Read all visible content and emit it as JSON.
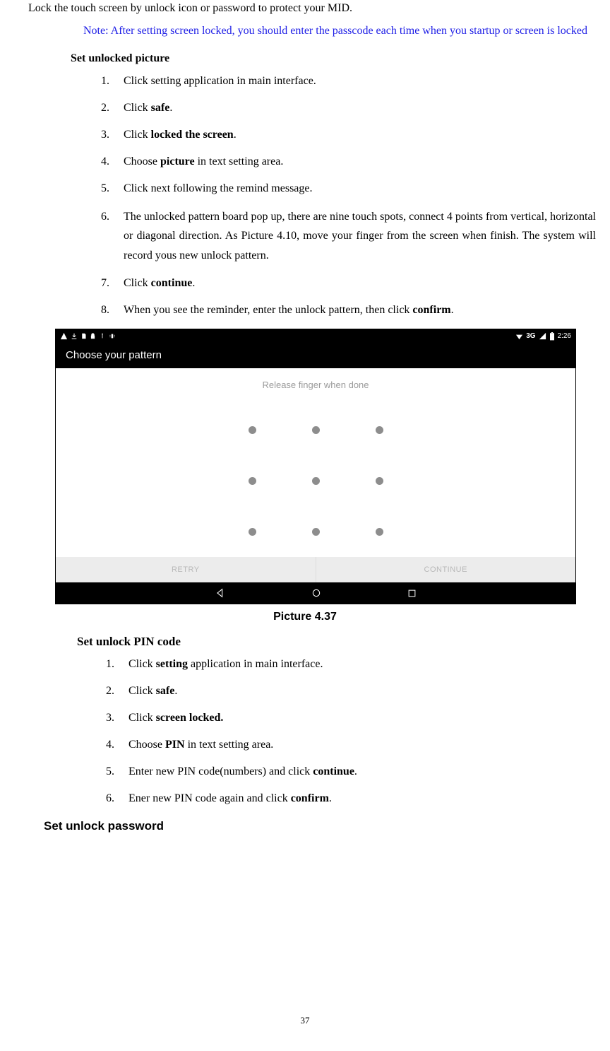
{
  "intro": "Lock the touch screen by unlock icon or password to protect your MID.",
  "note": "Note: After setting screen locked, you should enter the passcode each time when you startup or screen is locked",
  "section1_title": "Set unlocked picture",
  "s1": {
    "i1": {
      "pre": "Click setting application in main interface."
    },
    "i2": {
      "a": "Click ",
      "b": "safe",
      "c": "."
    },
    "i3": {
      "a": "Click ",
      "b": "locked the screen",
      "c": "."
    },
    "i4": {
      "a": "Choose ",
      "b": "picture",
      "c": " in text setting area."
    },
    "i5": {
      "pre": "Click next following the remind message."
    },
    "i6": {
      "pre": "The unlocked pattern board pop up, there are nine touch spots, connect 4 points from vertical, horizontal or diagonal direction. As Picture 4.10, move your finger from the screen when finish. The system will record yous new unlock pattern."
    },
    "i7": {
      "a": "Click ",
      "b": "continue",
      "c": "."
    },
    "i8": {
      "a": "When you see the reminder, enter the unlock pattern, then click ",
      "b": "confirm",
      "c": "."
    }
  },
  "shot": {
    "status_network": "3G",
    "status_time": "2:26",
    "title": "Choose your pattern",
    "hint": "Release finger when done",
    "retry": "RETRY",
    "continue": "CONTINUE"
  },
  "caption": "Picture 4.37",
  "section2_title": "Set unlock PIN code",
  "s2": {
    "i1": {
      "a": "Click ",
      "b": "setting",
      "c": " application in main interface."
    },
    "i2": {
      "a": "Click ",
      "b": "safe",
      "c": "."
    },
    "i3": {
      "a": "Click ",
      "b": "screen locked.",
      "c": ""
    },
    "i4": {
      "a": "Choose ",
      "b": "PIN",
      "c": " in text setting area."
    },
    "i5": {
      "a": "Enter new PIN code(numbers) and click ",
      "b": "continue",
      "c": "."
    },
    "i6": {
      "a": "Ener new PIN code again and click ",
      "b": "confirm",
      "c": "."
    }
  },
  "section3_title": "Set unlock password",
  "page_number": "37"
}
